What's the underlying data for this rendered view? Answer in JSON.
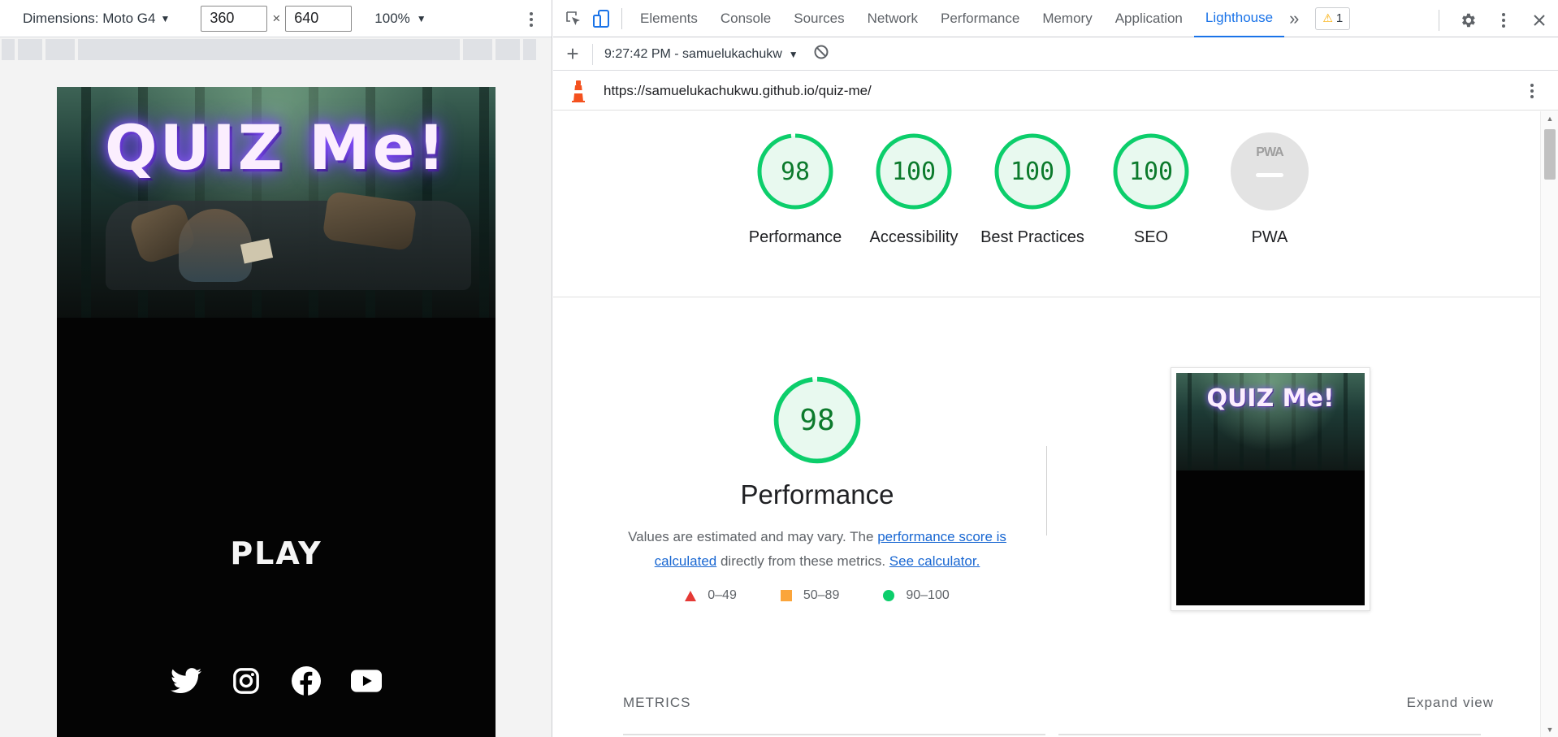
{
  "device_toolbar": {
    "dimensions_label": "Dimensions: Moto G4",
    "width": "360",
    "height": "640",
    "times": "×",
    "zoom": "100%"
  },
  "app": {
    "title": "QUIZ Me!",
    "play_label": "PLAY",
    "social_icons": [
      "twitter-icon",
      "instagram-icon",
      "facebook-icon",
      "youtube-icon"
    ]
  },
  "devtools": {
    "tabs": [
      "Elements",
      "Console",
      "Sources",
      "Network",
      "Performance",
      "Memory",
      "Application",
      "Lighthouse"
    ],
    "active_tab": "Lighthouse",
    "more_tabs": "»",
    "warning_count": "1"
  },
  "lighthouse": {
    "report_label": "9:27:42 PM - samuelukachukw",
    "url": "https://samuelukachukwu.github.io/quiz-me/",
    "scores": [
      {
        "label": "Performance",
        "value": 98
      },
      {
        "label": "Accessibility",
        "value": 100
      },
      {
        "label": "Best Practices",
        "value": 100
      },
      {
        "label": "SEO",
        "value": 100
      }
    ],
    "pwa": {
      "label": "PWA",
      "badge": "PWA"
    },
    "performance": {
      "score": "98",
      "title": "Performance",
      "desc_prefix": "Values are estimated and may vary. The ",
      "desc_link1": "performance score is calculated",
      "desc_middle": " directly from these metrics. ",
      "desc_link2": "See calculator."
    },
    "legend": [
      {
        "shape": "triangle",
        "range": "0–49",
        "color": "#e53935"
      },
      {
        "shape": "square",
        "range": "50–89",
        "color": "#fba53b"
      },
      {
        "shape": "circle",
        "range": "90–100",
        "color": "#0cce6b"
      }
    ],
    "thumbnail_title": "QUIZ Me!",
    "metrics_label": "METRICS",
    "expand_label": "Expand view"
  },
  "colors": {
    "pass": "#0cce6b",
    "pass_fill": "#e8f9ef",
    "pass_text": "#0c7a2c",
    "accent": "#1a73e8"
  }
}
